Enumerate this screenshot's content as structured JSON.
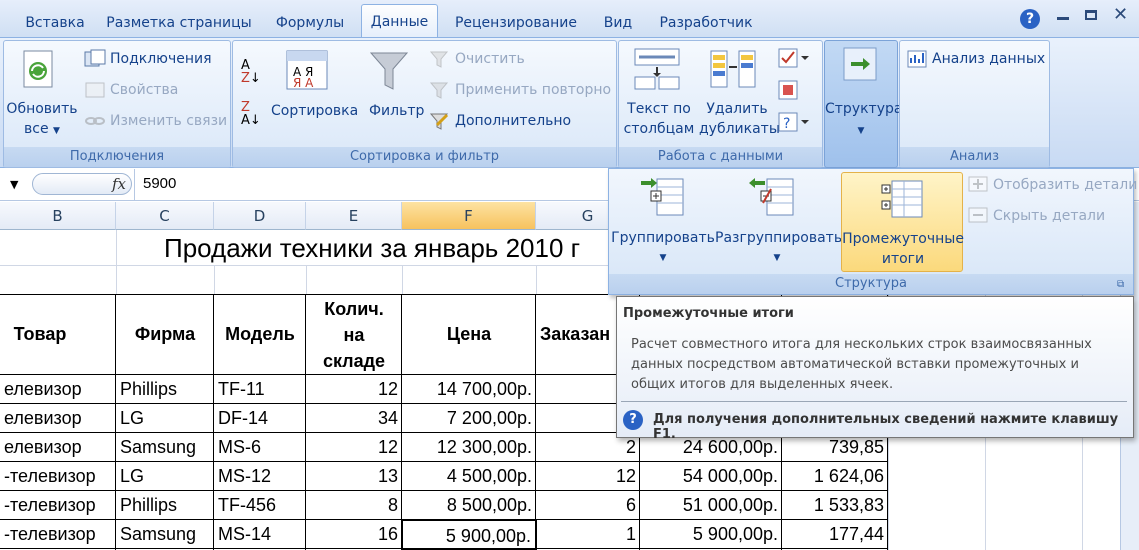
{
  "tabs": [
    "Вставка",
    "Разметка страницы",
    "Формулы",
    "Данные",
    "Рецензирование",
    "Вид",
    "Разработчик"
  ],
  "active_tab": "Данные",
  "groups": {
    "connections": {
      "label": "Подключения",
      "refresh_label": "Обновить",
      "refresh_label2": "все",
      "connections": "Подключения",
      "properties": "Свойства",
      "edit_links": "Изменить связи"
    },
    "sort_filter": {
      "label": "Сортировка и фильтр",
      "sort": "Сортировка",
      "filter": "Фильтр",
      "clear": "Очистить",
      "reapply": "Применить повторно",
      "advanced": "Дополнительно",
      "az_icon_text": "А Я",
      "ya_icon_text": "Я А"
    },
    "data_tools": {
      "label": "Работа с данными",
      "text_to_columns_1": "Текст по",
      "text_to_columns_2": "столбцам",
      "remove_dup_1": "Удалить",
      "remove_dup_2": "дубликаты"
    },
    "outline": {
      "label": "Структура"
    },
    "analysis": {
      "label": "Анализ",
      "data_analysis": "Анализ данных"
    }
  },
  "formula_bar": {
    "fx": "fx",
    "value": "5900"
  },
  "outline_panel": {
    "group": "Группировать",
    "ungroup": "Разгруппировать",
    "subtotal_1": "Промежуточные",
    "subtotal_2": "итоги",
    "show_detail": "Отобразить детали",
    "hide_detail": "Скрыть детали",
    "label": "Структура"
  },
  "tooltip": {
    "title": "Промежуточные итоги",
    "body_1": "Расчет совместного итога для нескольких строк взаимосвязанных",
    "body_2": "данных посредством автоматической вставки промежуточных и",
    "body_3": "общих итогов для выделенных ячеек.",
    "help": "Для получения дополнительных сведений нажмите клавишу F1."
  },
  "columns": [
    "B",
    "C",
    "D",
    "E",
    "F",
    "G"
  ],
  "sheet": {
    "title": "Продажи техники за январь 2010 г",
    "headers": {
      "product": "Товар",
      "firm": "Фирма",
      "model": "Модель",
      "qty_1": "Колич.",
      "qty_2": "на",
      "qty_3": "складе",
      "price": "Цена",
      "ordered": "Заказан"
    },
    "rows": [
      {
        "product": "елевизор",
        "firm": "Phillips",
        "model": "TF-11",
        "qty": "12",
        "price": "14 700,00р.",
        "ordered": "",
        "sum": "",
        "extra": ""
      },
      {
        "product": "елевизор",
        "firm": "LG",
        "model": "DF-14",
        "qty": "34",
        "price": "7 200,00р.",
        "ordered": "",
        "sum": "",
        "extra": ""
      },
      {
        "product": "елевизор",
        "firm": "Samsung",
        "model": "MS-6",
        "qty": "12",
        "price": "12 300,00р.",
        "ordered": "2",
        "sum": "24 600,00р.",
        "extra": "739,85"
      },
      {
        "product": "-телевизор",
        "firm": "LG",
        "model": "MS-12",
        "qty": "13",
        "price": "4 500,00р.",
        "ordered": "12",
        "sum": "54 000,00р.",
        "extra": "1 624,06"
      },
      {
        "product": "-телевизор",
        "firm": "Phillips",
        "model": "TF-456",
        "qty": "8",
        "price": "8 500,00р.",
        "ordered": "6",
        "sum": "51 000,00р.",
        "extra": "1 533,83"
      },
      {
        "product": "-телевизор",
        "firm": "Samsung",
        "model": "MS-14",
        "qty": "16",
        "price": "5 900,00р.",
        "ordered": "1",
        "sum": "5 900,00р.",
        "extra": "177,44"
      }
    ]
  },
  "colors": {
    "ribbon_text": "#15428b",
    "selected_highlight": "#fbd97c"
  }
}
